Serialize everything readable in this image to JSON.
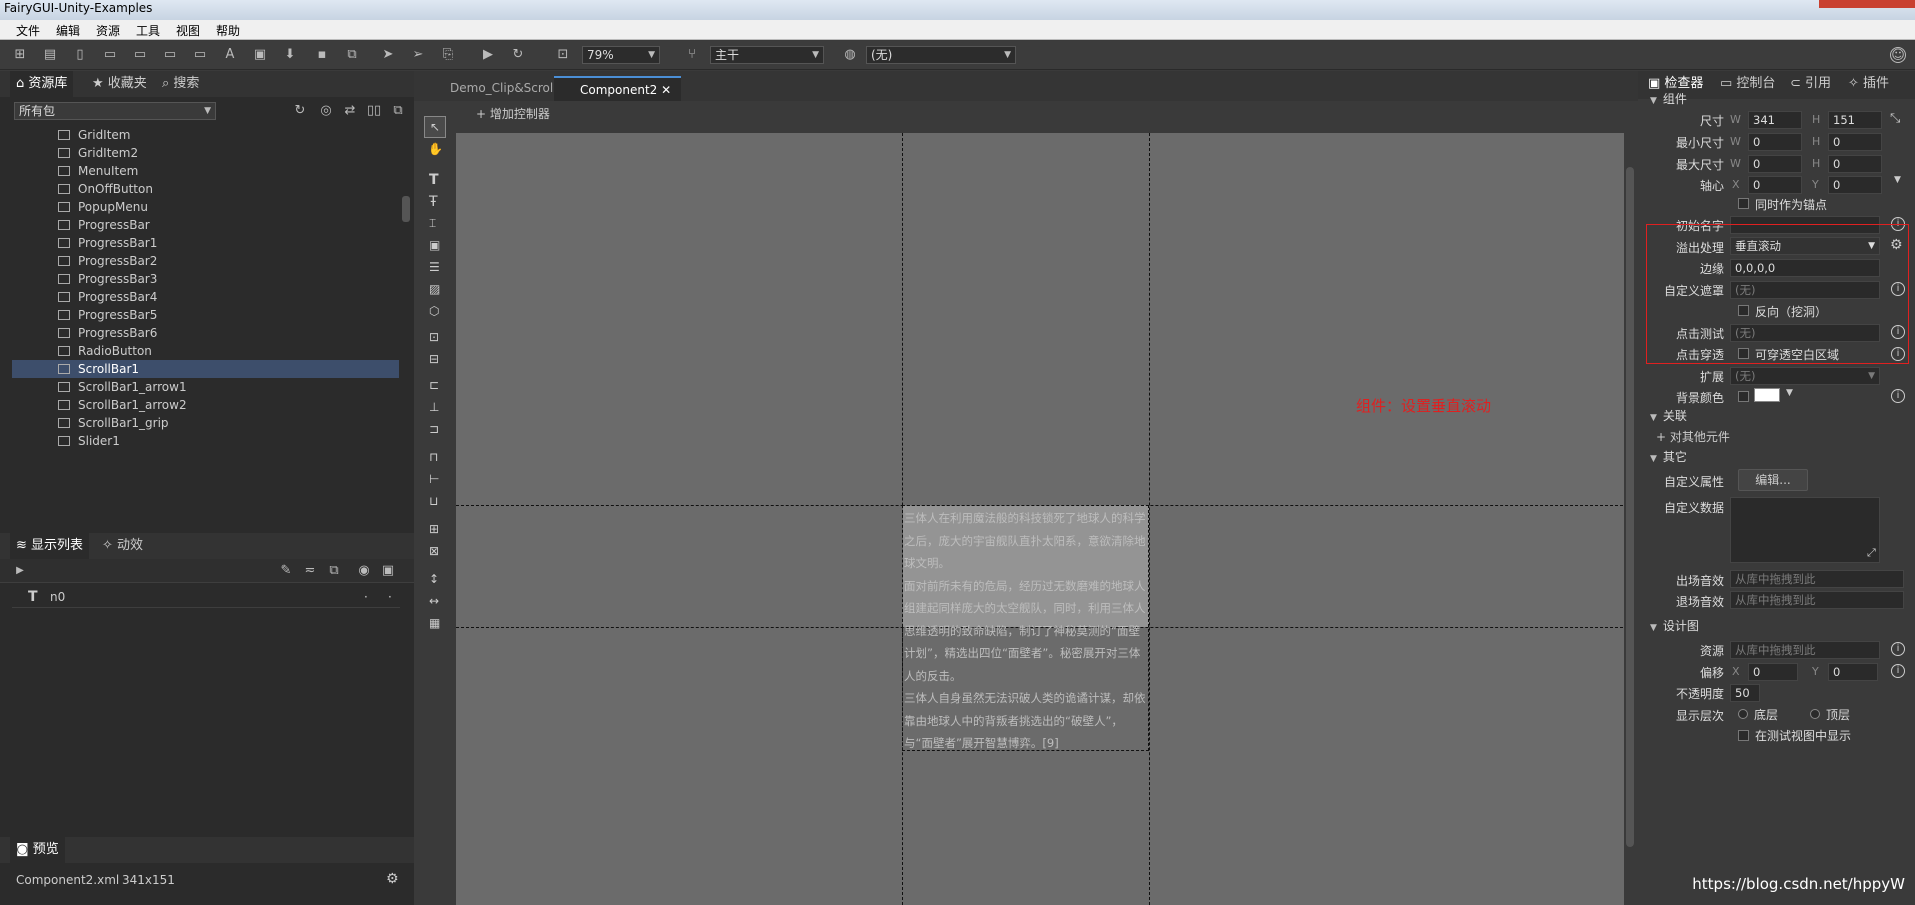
{
  "window": {
    "title": "FairyGUI-Unity-Examples"
  },
  "menu": {
    "items": [
      "文件",
      "编辑",
      "资源",
      "工具",
      "视图",
      "帮助"
    ]
  },
  "toolbar": {
    "zoom": "79%",
    "branch": "主干",
    "language": "(无)"
  },
  "library": {
    "tabs": [
      "资源库",
      "收藏夹",
      "搜索"
    ],
    "filter": "所有包",
    "items": [
      {
        "label": "GridItem"
      },
      {
        "label": "GridItem2"
      },
      {
        "label": "MenuItem"
      },
      {
        "label": "OnOffButton"
      },
      {
        "label": "PopupMenu"
      },
      {
        "label": "ProgressBar"
      },
      {
        "label": "ProgressBar1"
      },
      {
        "label": "ProgressBar2"
      },
      {
        "label": "ProgressBar3"
      },
      {
        "label": "ProgressBar4"
      },
      {
        "label": "ProgressBar5"
      },
      {
        "label": "ProgressBar6"
      },
      {
        "label": "RadioButton"
      },
      {
        "label": "ScrollBar1"
      },
      {
        "label": "ScrollBar1_arrow1"
      },
      {
        "label": "ScrollBar1_arrow2"
      },
      {
        "label": "ScrollBar1_grip"
      },
      {
        "label": "Slider1"
      }
    ],
    "selected_index": 13
  },
  "display_list": {
    "tabs": [
      "显示列表",
      "动效"
    ],
    "items": [
      {
        "label": "n0"
      }
    ]
  },
  "preview": {
    "tab": "预览",
    "file": "Component2.xml",
    "size": "341x151"
  },
  "doc_tabs": [
    "Demo_Clip&Scroll",
    "Component2"
  ],
  "controller_bar": {
    "add_label": "增加控制器"
  },
  "canvas": {
    "annotation": "组件：设置垂直滚动",
    "paragraphs": [
      "三体人在利用魔法般的科技锁死了地球人的科学之后，庞大的宇宙舰队直扑太阳系，意欲清除地球文明。",
      "面对前所未有的危局，经历过无数磨难的地球人组建起同样庞大的太空舰队，同时，利用三体人思维透明的致命缺陷，制订了神秘莫测的“面壁计划”，精选出四位“面壁者”。秘密展开对三体人的反击。",
      "三体人自身虽然无法识破人类的诡谲计谋，却依靠由地球人中的背叛者挑选出的“破壁人”，与“面壁者”展开智慧博弈。[9]"
    ]
  },
  "inspector": {
    "tabs": [
      "检查器",
      "控制台",
      "引用",
      "插件"
    ],
    "sections": {
      "component": "组件",
      "relation": "关联",
      "other": "其它",
      "design": "设计图"
    },
    "labels": {
      "size": "尺寸",
      "min_size": "最小尺寸",
      "max_size": "最大尺寸",
      "pivot": "轴心",
      "pivot_anchor": "同时作为锚点",
      "init_name": "初始名字",
      "overflow": "溢出处理",
      "margin": "边缘",
      "custom_mask": "自定义遮罩",
      "reverse": "反向（挖洞）",
      "hit_test": "点击测试",
      "click_through": "点击穿透",
      "click_through_opt": "可穿透空白区域",
      "extension": "扩展",
      "bg_color": "背景颜色",
      "add_relation": "对其他元件",
      "custom_props": "自定义属性",
      "edit": "编辑...",
      "custom_data": "自定义数据",
      "enter_sound": "出场音效",
      "exit_sound": "退场音效",
      "resource": "资源",
      "offset": "偏移",
      "opacity": "不透明度",
      "layer": "显示层次",
      "bottom": "底层",
      "top": "顶层",
      "show_in_test": "在测试视图中显示"
    },
    "values": {
      "w": "341",
      "h": "151",
      "min_w": "0",
      "min_h": "0",
      "max_w": "0",
      "max_h": "0",
      "pivot_x": "0",
      "pivot_y": "0",
      "overflow": "垂直滚动",
      "margin": "0,0,0,0",
      "none": "(无)",
      "drag_hint": "从库中拖拽到此",
      "offset_x": "0",
      "offset_y": "0",
      "opacity": "50"
    }
  },
  "watermark": "https://blog.csdn.net/hppyW"
}
